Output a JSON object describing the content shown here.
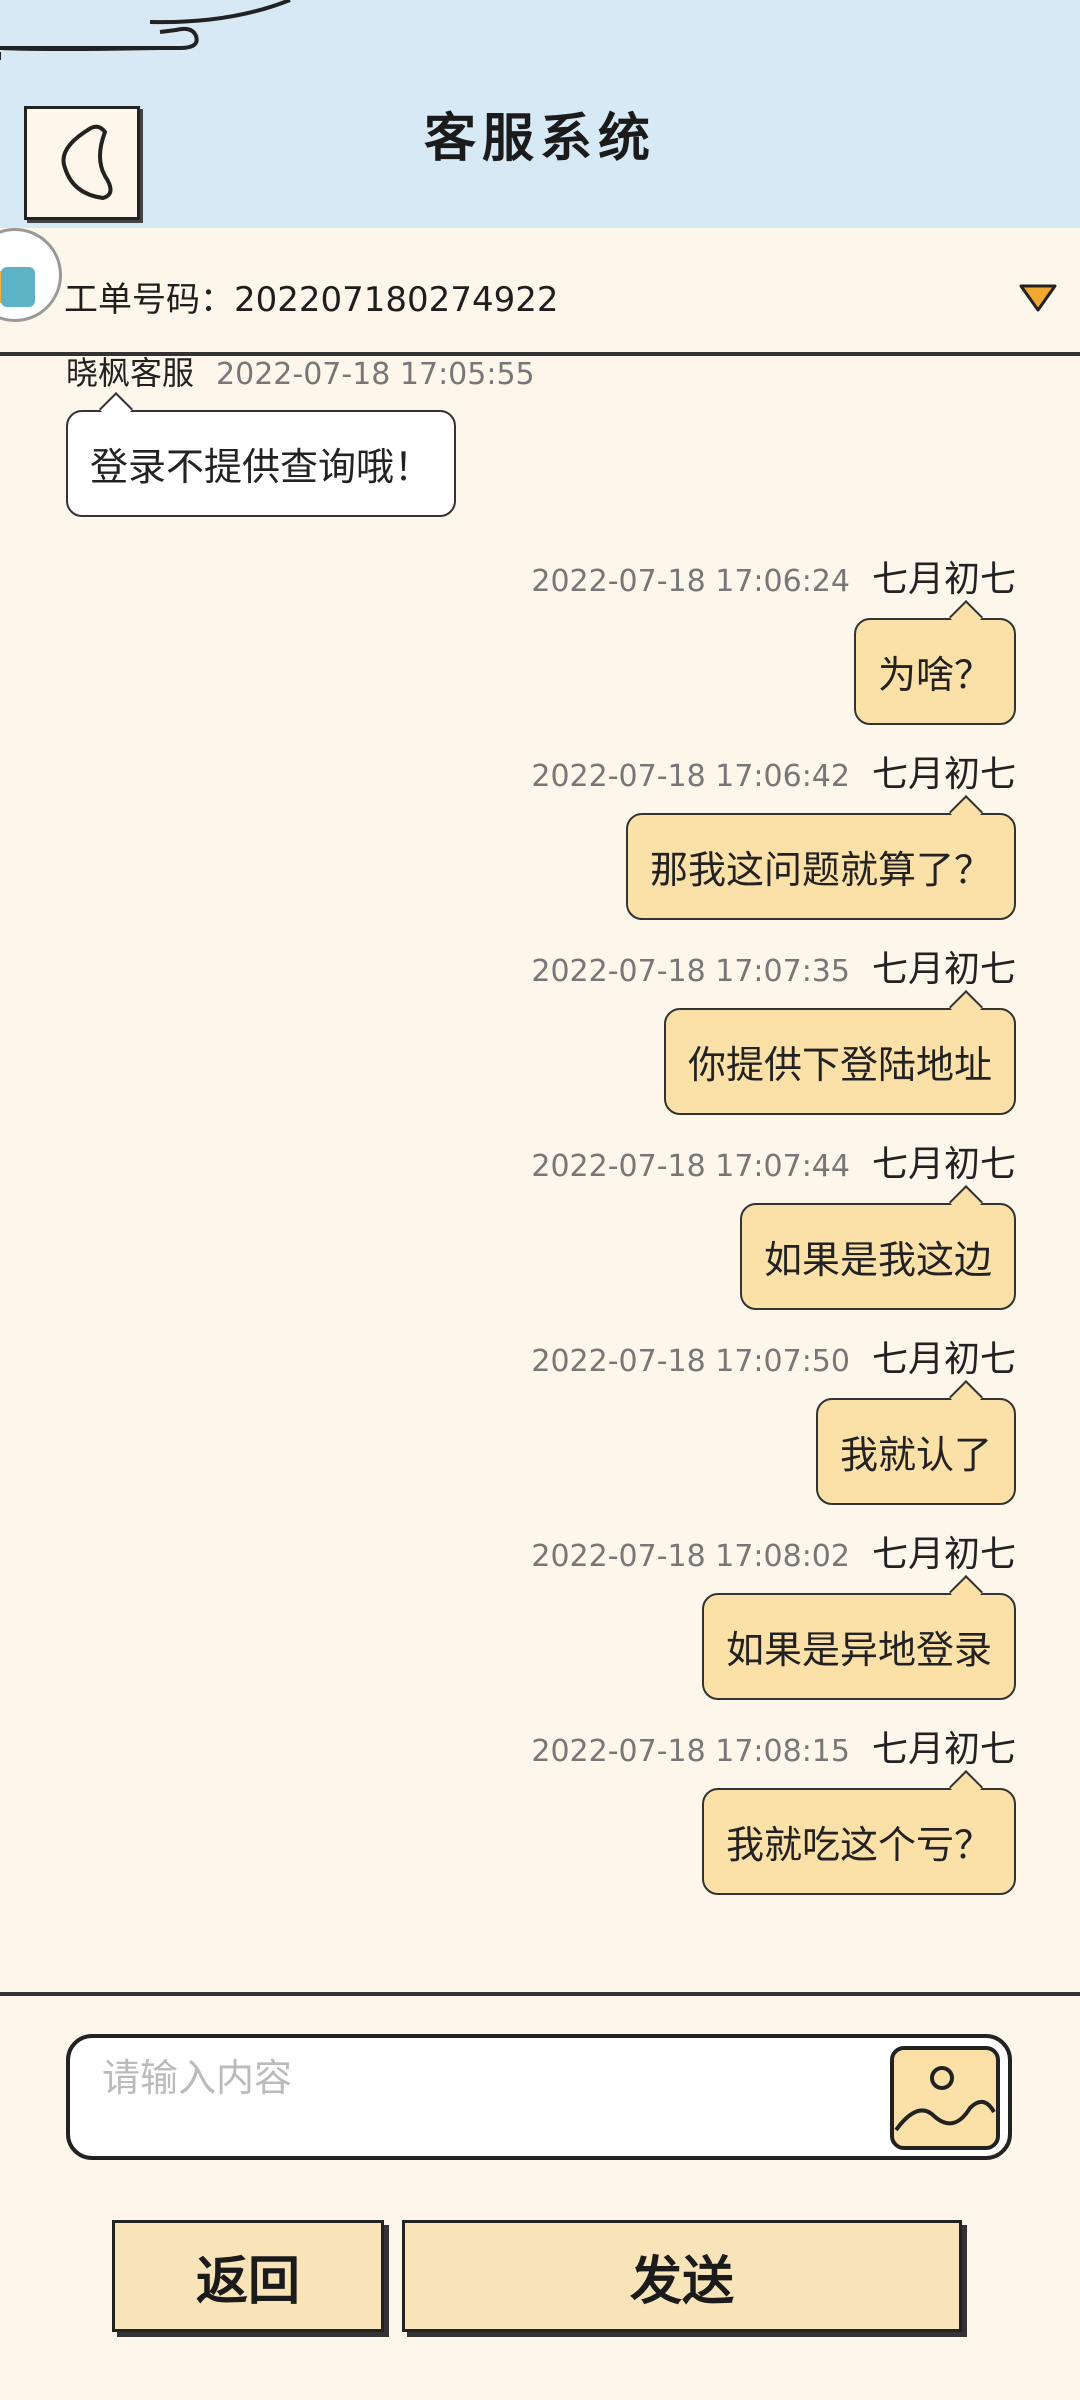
{
  "header": {
    "title": "客服系统"
  },
  "ticket": {
    "label": "工单号码：202207180274922"
  },
  "messages": [
    {
      "side": "left",
      "sender": "晓枫客服",
      "time": "2022-07-18 17:05:55",
      "text": "登录不提供查询哦！"
    },
    {
      "side": "right",
      "sender": "七月初七",
      "time": "2022-07-18 17:06:24",
      "text": "为啥？"
    },
    {
      "side": "right",
      "sender": "七月初七",
      "time": "2022-07-18 17:06:42",
      "text": "那我这问题就算了？"
    },
    {
      "side": "right",
      "sender": "七月初七",
      "time": "2022-07-18 17:07:35",
      "text": "你提供下登陆地址"
    },
    {
      "side": "right",
      "sender": "七月初七",
      "time": "2022-07-18 17:07:44",
      "text": "如果是我这边"
    },
    {
      "side": "right",
      "sender": "七月初七",
      "time": "2022-07-18 17:07:50",
      "text": "我就认了"
    },
    {
      "side": "right",
      "sender": "七月初七",
      "time": "2022-07-18 17:08:02",
      "text": "如果是异地登录"
    },
    {
      "side": "right",
      "sender": "七月初七",
      "time": "2022-07-18 17:08:15",
      "text": "我就吃这个亏？"
    }
  ],
  "input": {
    "placeholder": "请输入内容"
  },
  "buttons": {
    "back": "返回",
    "send": "发送"
  },
  "colors": {
    "header_bg": "#d8e9f6",
    "page_bg": "#fdf6ea",
    "user_bubble": "#fbe0a8",
    "button_bg": "#f8e4b8"
  }
}
